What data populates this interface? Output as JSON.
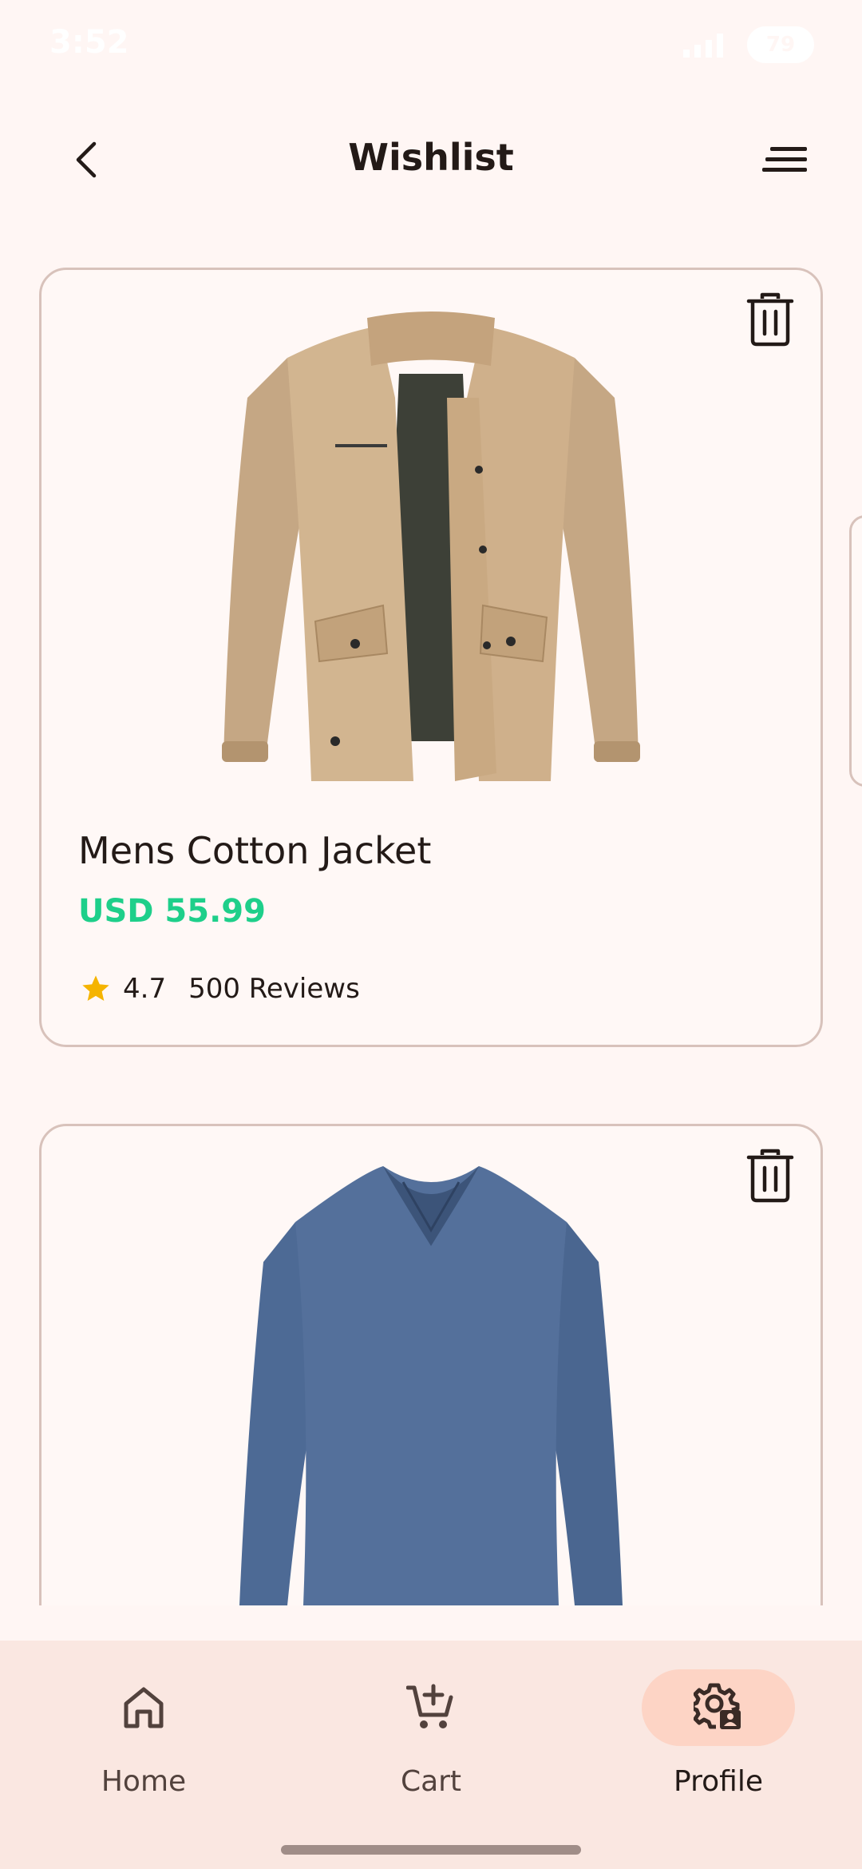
{
  "status_bar": {
    "time": "3:52",
    "battery": "79"
  },
  "app_bar": {
    "title": "Wishlist",
    "back_icon": "chevron-left-icon",
    "sort_icon": "sort-lines-icon"
  },
  "wishlist": [
    {
      "name": "Mens Cotton Jacket",
      "price": "USD 55.99",
      "rating": "4.7",
      "reviews": "500 Reviews",
      "image": "khaki-cotton-jacket",
      "delete_icon": "trash-icon"
    },
    {
      "image": "blue-long-sleeve-v-neck-shirt",
      "delete_icon": "trash-icon"
    }
  ],
  "colors": {
    "price": "#1ecf8a",
    "star": "#f5b400",
    "active_nav": "#fdd4c5",
    "background": "#fff6f4"
  },
  "bottom_nav": {
    "items": [
      {
        "label": "Home",
        "icon": "home-icon",
        "active": false
      },
      {
        "label": "Cart",
        "icon": "cart-add-icon",
        "active": false
      },
      {
        "label": "Profile",
        "icon": "profile-settings-icon",
        "active": true
      }
    ]
  }
}
